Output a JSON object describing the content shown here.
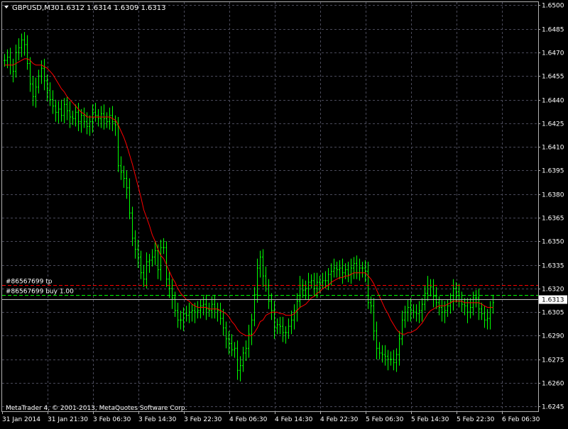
{
  "header": {
    "symbol": "GBPUSD,M30",
    "ohlc": "1.6312 1.6314 1.6309 1.6313",
    "dropdown_icon": "triangle-down-icon"
  },
  "footer": {
    "copyright": "MetaTrader 4, © 2001-2013, MetaQuotes Software Corp."
  },
  "order_lines": {
    "tp": {
      "label": "#86567699 tp",
      "price": 1.6322,
      "color": "#ff0000"
    },
    "buy": {
      "label": "#86567699 buy 1.00",
      "price": 1.6316,
      "color": "#00ff00"
    }
  },
  "current_price": {
    "label": "1.6313",
    "price": 1.6313
  },
  "colors": {
    "background": "#000000",
    "grid": "#4a4a5a",
    "candle": "#00ff00",
    "moving_average": "#ff0000",
    "text": "#ffffff"
  },
  "chart_data": {
    "type": "candlestick",
    "ylim": [
      1.6242,
      1.6502
    ],
    "y_ticks": [
      "1.6500",
      "1.6485",
      "1.6470",
      "1.6455",
      "1.6440",
      "1.6425",
      "1.6410",
      "1.6395",
      "1.6380",
      "1.6365",
      "1.6350",
      "1.6335",
      "1.6320",
      "1.6305",
      "1.6290",
      "1.6275",
      "1.6260",
      "1.6245"
    ],
    "x_ticks": [
      "31 Jan 2014",
      "31 Jan 21:30",
      "3 Feb 06:30",
      "3 Feb 14:30",
      "3 Feb 22:30",
      "4 Feb 06:30",
      "4 Feb 14:30",
      "4 Feb 22:30",
      "5 Feb 06:30",
      "5 Feb 14:30",
      "5 Feb 22:30",
      "6 Feb 06:30"
    ],
    "grid": true,
    "series": [
      {
        "name": "GBPUSD M30",
        "style": "bars",
        "close": [
          1.6465,
          1.6467,
          1.6462,
          1.6458,
          1.647,
          1.6473,
          1.6478,
          1.6475,
          1.6463,
          1.645,
          1.6442,
          1.6448,
          1.6455,
          1.646,
          1.6452,
          1.6446,
          1.644,
          1.6436,
          1.6432,
          1.6434,
          1.643,
          1.6437,
          1.6433,
          1.6429,
          1.6428,
          1.6432,
          1.6426,
          1.643,
          1.6426,
          1.6423,
          1.6426,
          1.6432,
          1.643,
          1.6428,
          1.6431,
          1.6428,
          1.6426,
          1.643,
          1.6426,
          1.6424,
          1.6398,
          1.6394,
          1.639,
          1.6384,
          1.6368,
          1.6352,
          1.6345,
          1.634,
          1.633,
          1.6326,
          1.6337,
          1.6338,
          1.634,
          1.6344,
          1.6332,
          1.6346,
          1.6346,
          1.6326,
          1.632,
          1.6314,
          1.6306,
          1.63,
          1.63,
          1.6304,
          1.6303,
          1.6305,
          1.6306,
          1.6305,
          1.6306,
          1.6309,
          1.631,
          1.6307,
          1.6306,
          1.631,
          1.6307,
          1.6306,
          1.6301,
          1.6295,
          1.6288,
          1.6285,
          1.6281,
          1.6282,
          1.6268,
          1.6271,
          1.6279,
          1.6282,
          1.6291,
          1.63,
          1.6316,
          1.6333,
          1.634,
          1.6328,
          1.6322,
          1.6312,
          1.6306,
          1.6295,
          1.6297,
          1.6296,
          1.6292,
          1.6292,
          1.6296,
          1.63,
          1.6306,
          1.6312,
          1.6322,
          1.6319,
          1.632,
          1.6324,
          1.6325,
          1.632,
          1.6324,
          1.6324,
          1.6325,
          1.6325,
          1.6329,
          1.6331,
          1.6333,
          1.6332,
          1.6333,
          1.633,
          1.6332,
          1.6329,
          1.6333,
          1.6336,
          1.633,
          1.6333,
          1.6333,
          1.6331,
          1.6311,
          1.6309,
          1.6293,
          1.6282,
          1.6279,
          1.6278,
          1.6277,
          1.6275,
          1.6275,
          1.6273,
          1.6278,
          1.6288,
          1.63,
          1.6305,
          1.6308,
          1.6306,
          1.6305,
          1.6304,
          1.6306,
          1.631,
          1.6317,
          1.6322,
          1.6321,
          1.6315,
          1.6311,
          1.6308,
          1.6305,
          1.6306,
          1.6309,
          1.6312,
          1.632,
          1.6318,
          1.6312,
          1.631,
          1.6309,
          1.6305,
          1.6308,
          1.6314,
          1.6314,
          1.6307,
          1.6304,
          1.63,
          1.6301,
          1.6308,
          1.6311
        ]
      },
      {
        "name": "Moving Average",
        "style": "line",
        "values": [
          1.6462,
          1.6462,
          1.6462,
          1.6462,
          1.6463,
          1.6464,
          1.6465,
          1.6466,
          1.6466,
          1.6465,
          1.6463,
          1.6462,
          1.6462,
          1.6462,
          1.6461,
          1.646,
          1.6458,
          1.6456,
          1.6453,
          1.645,
          1.6447,
          1.6445,
          1.6442,
          1.644,
          1.6438,
          1.6436,
          1.6434,
          1.6432,
          1.6431,
          1.6429,
          1.6429,
          1.6429,
          1.6429,
          1.6429,
          1.6429,
          1.6429,
          1.6429,
          1.6429,
          1.6428,
          1.6427,
          1.6424,
          1.642,
          1.6416,
          1.6411,
          1.6405,
          1.6399,
          1.6392,
          1.6385,
          1.6378,
          1.637,
          1.6365,
          1.636,
          1.6354,
          1.635,
          1.6345,
          1.6341,
          1.6339,
          1.6335,
          1.6331,
          1.6327,
          1.6324,
          1.632,
          1.6317,
          1.6315,
          1.6313,
          1.6312,
          1.631,
          1.6309,
          1.6308,
          1.6308,
          1.6308,
          1.6308,
          1.6307,
          1.6307,
          1.6307,
          1.6307,
          1.6306,
          1.6305,
          1.6304,
          1.6302,
          1.6299,
          1.6297,
          1.6294,
          1.6292,
          1.6291,
          1.629,
          1.629,
          1.629,
          1.6292,
          1.6295,
          1.6299,
          1.63,
          1.6303,
          1.6304,
          1.6305,
          1.6305,
          1.6305,
          1.6304,
          1.6304,
          1.6303,
          1.6303,
          1.6303,
          1.6304,
          1.6306,
          1.6308,
          1.6309,
          1.631,
          1.6312,
          1.6314,
          1.6315,
          1.6317,
          1.6318,
          1.632,
          1.6321,
          1.6322,
          1.6324,
          1.6325,
          1.6326,
          1.6327,
          1.6327,
          1.6328,
          1.6328,
          1.6329,
          1.633,
          1.633,
          1.633,
          1.633,
          1.633,
          1.6328,
          1.6326,
          1.6323,
          1.6319,
          1.6315,
          1.6311,
          1.6307,
          1.6304,
          1.63,
          1.6297,
          1.6294,
          1.6292,
          1.6291,
          1.6291,
          1.6292,
          1.6292,
          1.6293,
          1.6294,
          1.6296,
          1.6298,
          1.6301,
          1.6304,
          1.6306,
          1.6307,
          1.6308,
          1.6309,
          1.6309,
          1.6309,
          1.631,
          1.6311,
          1.6312,
          1.6312,
          1.6312,
          1.6312,
          1.6311,
          1.6311,
          1.6311,
          1.6311,
          1.6311,
          1.6311,
          1.631,
          1.6309,
          1.6308,
          1.6308,
          1.6308
        ]
      }
    ]
  }
}
